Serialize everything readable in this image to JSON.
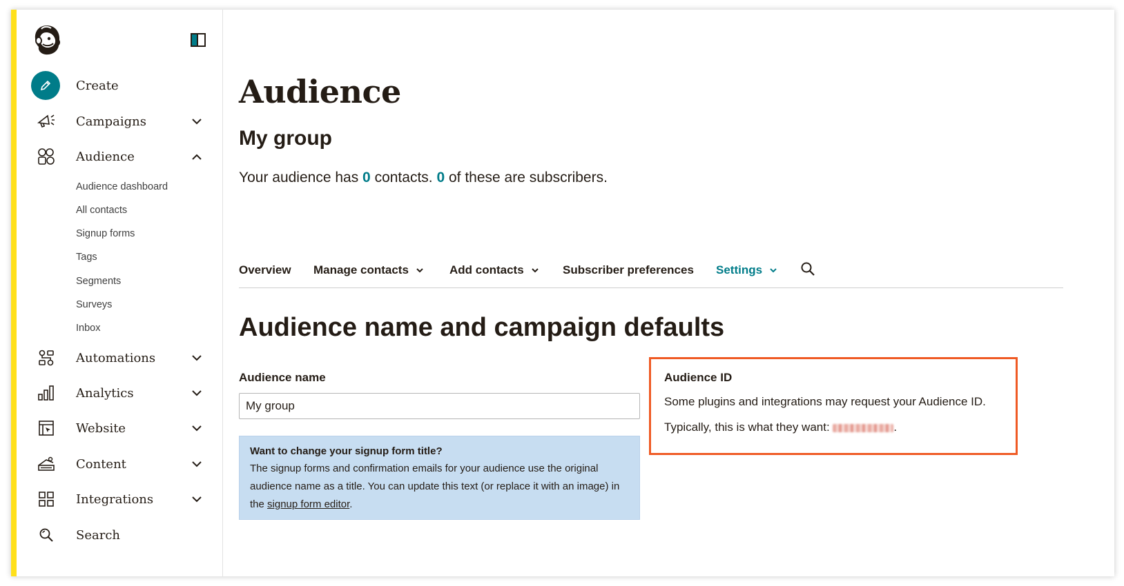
{
  "sidebar": {
    "create_label": "Create",
    "nav": [
      {
        "label": "Campaigns"
      },
      {
        "label": "Audience"
      },
      {
        "label": "Automations"
      },
      {
        "label": "Analytics"
      },
      {
        "label": "Website"
      },
      {
        "label": "Content"
      },
      {
        "label": "Integrations"
      },
      {
        "label": "Search"
      }
    ],
    "audience_sub": [
      "Audience dashboard",
      "All contacts",
      "Signup forms",
      "Tags",
      "Segments",
      "Surveys",
      "Inbox"
    ]
  },
  "page": {
    "title": "Audience",
    "group_name": "My group",
    "summary": {
      "prefix": "Your audience has ",
      "contacts": "0",
      "middle": " contacts. ",
      "subscribers": "0",
      "suffix": " of these are subscribers."
    }
  },
  "tabs": [
    {
      "label": "Overview"
    },
    {
      "label": "Manage contacts"
    },
    {
      "label": "Add contacts"
    },
    {
      "label": "Subscriber preferences"
    },
    {
      "label": "Settings"
    }
  ],
  "settings": {
    "section_title": "Audience name and campaign defaults",
    "audience_name_label": "Audience name",
    "audience_name_value": "My group",
    "info": {
      "title": "Want to change your signup form title?",
      "body": "The signup forms and confirmation emails for your audience use the original audience name as a title. You can update this text (or replace it with an image) in the ",
      "link": "signup form editor",
      "end": "."
    },
    "audience_id": {
      "title": "Audience ID",
      "line1": "Some plugins and integrations may request your Audience ID.",
      "line2": "Typically, this is what they want: ",
      "line2_end": "."
    }
  },
  "colors": {
    "accent": "#007c89",
    "brand_yellow": "#ffe01b",
    "highlight": "#ef5a24",
    "info_bg": "#c7ddf1"
  },
  "icons": [
    "freddie-logo-icon",
    "sidebar-toggle-icon",
    "pencil-icon",
    "megaphone-icon",
    "audience-icon",
    "automations-icon",
    "analytics-icon",
    "website-icon",
    "content-icon",
    "integrations-icon",
    "search-icon",
    "chevron-down-icon",
    "chevron-up-icon"
  ]
}
